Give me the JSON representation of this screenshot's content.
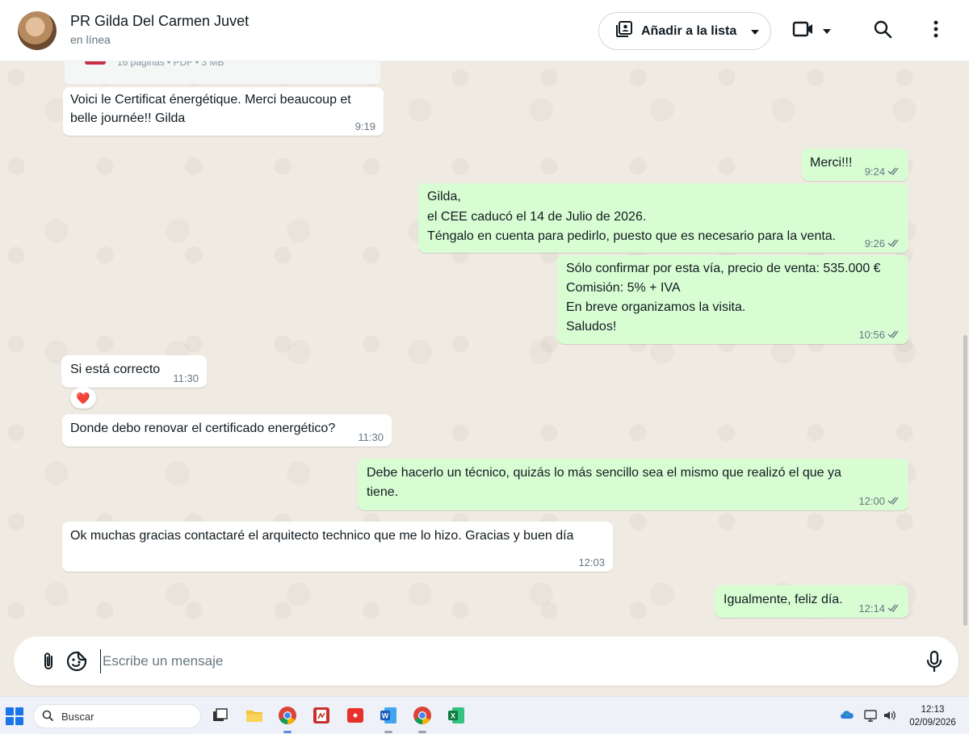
{
  "header": {
    "contact_name": "PR Gilda Del Carmen Juvet",
    "status": "en línea",
    "add_to_list_label": "Añadir a la lista"
  },
  "document": {
    "meta": "16 páginas • PDF • 3 MB"
  },
  "messages": [
    {
      "direction": "in",
      "lines": [
        "Voici le Certificat énergétique. Merci beaucoup et",
        "belle journée!! Gilda"
      ],
      "time": "9:19"
    },
    {
      "direction": "out",
      "lines": [
        "Merci!!!"
      ],
      "time": "9:24"
    },
    {
      "direction": "out",
      "lines": [
        "Gilda,",
        "el CEE caducó el 14 de Julio de 2026.",
        "Téngalo en cuenta para pedirlo, puesto que es necesario para la venta."
      ],
      "time": "9:26"
    },
    {
      "direction": "out",
      "lines": [
        "Sólo confirmar por esta vía, precio de venta: 535.000 €",
        "Comisión: 5% + IVA",
        "En breve organizamos la visita.",
        "Saludos!"
      ],
      "time": "10:56"
    },
    {
      "direction": "in",
      "lines": [
        "Si está correcto"
      ],
      "time": "11:30",
      "reaction": "❤️"
    },
    {
      "direction": "in",
      "lines": [
        "Donde debo renovar el certificado energético?"
      ],
      "time": "11:30"
    },
    {
      "direction": "out",
      "lines": [
        "Debe hacerlo un técnico, quizás lo más sencillo sea el mismo que realizó el que ya",
        "tiene."
      ],
      "time": "12:00"
    },
    {
      "direction": "in",
      "lines": [
        "Ok muchas gracias contactaré el arquitecto technico que me lo hizo. Gracias y buen día"
      ],
      "time": "12:03"
    },
    {
      "direction": "out",
      "lines": [
        "Igualmente, feliz día."
      ],
      "time": "12:14"
    }
  ],
  "composer": {
    "placeholder": "Escribe un mensaje"
  },
  "taskbar": {
    "search_label": "Buscar",
    "time": "12:13",
    "date": "02/09/2026"
  },
  "colors": {
    "outgoing_bubble": "#d9fdd3",
    "incoming_bubble": "#ffffff",
    "chat_background": "#efeae2",
    "read_ticks": "#667781"
  }
}
